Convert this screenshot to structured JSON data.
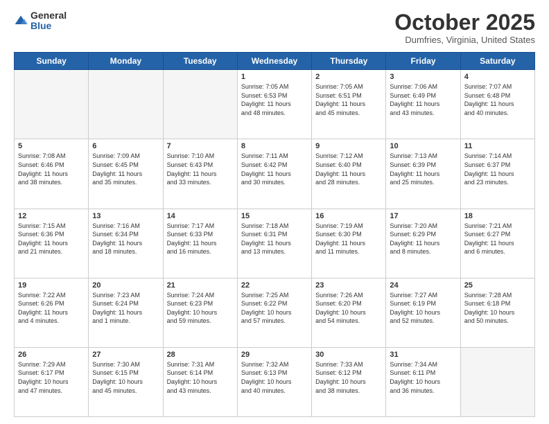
{
  "logo": {
    "general": "General",
    "blue": "Blue"
  },
  "title": "October 2025",
  "location": "Dumfries, Virginia, United States",
  "days_of_week": [
    "Sunday",
    "Monday",
    "Tuesday",
    "Wednesday",
    "Thursday",
    "Friday",
    "Saturday"
  ],
  "weeks": [
    [
      {
        "day": "",
        "info": ""
      },
      {
        "day": "",
        "info": ""
      },
      {
        "day": "",
        "info": ""
      },
      {
        "day": "1",
        "info": "Sunrise: 7:05 AM\nSunset: 6:53 PM\nDaylight: 11 hours\nand 48 minutes."
      },
      {
        "day": "2",
        "info": "Sunrise: 7:05 AM\nSunset: 6:51 PM\nDaylight: 11 hours\nand 45 minutes."
      },
      {
        "day": "3",
        "info": "Sunrise: 7:06 AM\nSunset: 6:49 PM\nDaylight: 11 hours\nand 43 minutes."
      },
      {
        "day": "4",
        "info": "Sunrise: 7:07 AM\nSunset: 6:48 PM\nDaylight: 11 hours\nand 40 minutes."
      }
    ],
    [
      {
        "day": "5",
        "info": "Sunrise: 7:08 AM\nSunset: 6:46 PM\nDaylight: 11 hours\nand 38 minutes."
      },
      {
        "day": "6",
        "info": "Sunrise: 7:09 AM\nSunset: 6:45 PM\nDaylight: 11 hours\nand 35 minutes."
      },
      {
        "day": "7",
        "info": "Sunrise: 7:10 AM\nSunset: 6:43 PM\nDaylight: 11 hours\nand 33 minutes."
      },
      {
        "day": "8",
        "info": "Sunrise: 7:11 AM\nSunset: 6:42 PM\nDaylight: 11 hours\nand 30 minutes."
      },
      {
        "day": "9",
        "info": "Sunrise: 7:12 AM\nSunset: 6:40 PM\nDaylight: 11 hours\nand 28 minutes."
      },
      {
        "day": "10",
        "info": "Sunrise: 7:13 AM\nSunset: 6:39 PM\nDaylight: 11 hours\nand 25 minutes."
      },
      {
        "day": "11",
        "info": "Sunrise: 7:14 AM\nSunset: 6:37 PM\nDaylight: 11 hours\nand 23 minutes."
      }
    ],
    [
      {
        "day": "12",
        "info": "Sunrise: 7:15 AM\nSunset: 6:36 PM\nDaylight: 11 hours\nand 21 minutes."
      },
      {
        "day": "13",
        "info": "Sunrise: 7:16 AM\nSunset: 6:34 PM\nDaylight: 11 hours\nand 18 minutes."
      },
      {
        "day": "14",
        "info": "Sunrise: 7:17 AM\nSunset: 6:33 PM\nDaylight: 11 hours\nand 16 minutes."
      },
      {
        "day": "15",
        "info": "Sunrise: 7:18 AM\nSunset: 6:31 PM\nDaylight: 11 hours\nand 13 minutes."
      },
      {
        "day": "16",
        "info": "Sunrise: 7:19 AM\nSunset: 6:30 PM\nDaylight: 11 hours\nand 11 minutes."
      },
      {
        "day": "17",
        "info": "Sunrise: 7:20 AM\nSunset: 6:29 PM\nDaylight: 11 hours\nand 8 minutes."
      },
      {
        "day": "18",
        "info": "Sunrise: 7:21 AM\nSunset: 6:27 PM\nDaylight: 11 hours\nand 6 minutes."
      }
    ],
    [
      {
        "day": "19",
        "info": "Sunrise: 7:22 AM\nSunset: 6:26 PM\nDaylight: 11 hours\nand 4 minutes."
      },
      {
        "day": "20",
        "info": "Sunrise: 7:23 AM\nSunset: 6:24 PM\nDaylight: 11 hours\nand 1 minute."
      },
      {
        "day": "21",
        "info": "Sunrise: 7:24 AM\nSunset: 6:23 PM\nDaylight: 10 hours\nand 59 minutes."
      },
      {
        "day": "22",
        "info": "Sunrise: 7:25 AM\nSunset: 6:22 PM\nDaylight: 10 hours\nand 57 minutes."
      },
      {
        "day": "23",
        "info": "Sunrise: 7:26 AM\nSunset: 6:20 PM\nDaylight: 10 hours\nand 54 minutes."
      },
      {
        "day": "24",
        "info": "Sunrise: 7:27 AM\nSunset: 6:19 PM\nDaylight: 10 hours\nand 52 minutes."
      },
      {
        "day": "25",
        "info": "Sunrise: 7:28 AM\nSunset: 6:18 PM\nDaylight: 10 hours\nand 50 minutes."
      }
    ],
    [
      {
        "day": "26",
        "info": "Sunrise: 7:29 AM\nSunset: 6:17 PM\nDaylight: 10 hours\nand 47 minutes."
      },
      {
        "day": "27",
        "info": "Sunrise: 7:30 AM\nSunset: 6:15 PM\nDaylight: 10 hours\nand 45 minutes."
      },
      {
        "day": "28",
        "info": "Sunrise: 7:31 AM\nSunset: 6:14 PM\nDaylight: 10 hours\nand 43 minutes."
      },
      {
        "day": "29",
        "info": "Sunrise: 7:32 AM\nSunset: 6:13 PM\nDaylight: 10 hours\nand 40 minutes."
      },
      {
        "day": "30",
        "info": "Sunrise: 7:33 AM\nSunset: 6:12 PM\nDaylight: 10 hours\nand 38 minutes."
      },
      {
        "day": "31",
        "info": "Sunrise: 7:34 AM\nSunset: 6:11 PM\nDaylight: 10 hours\nand 36 minutes."
      },
      {
        "day": "",
        "info": ""
      }
    ]
  ]
}
